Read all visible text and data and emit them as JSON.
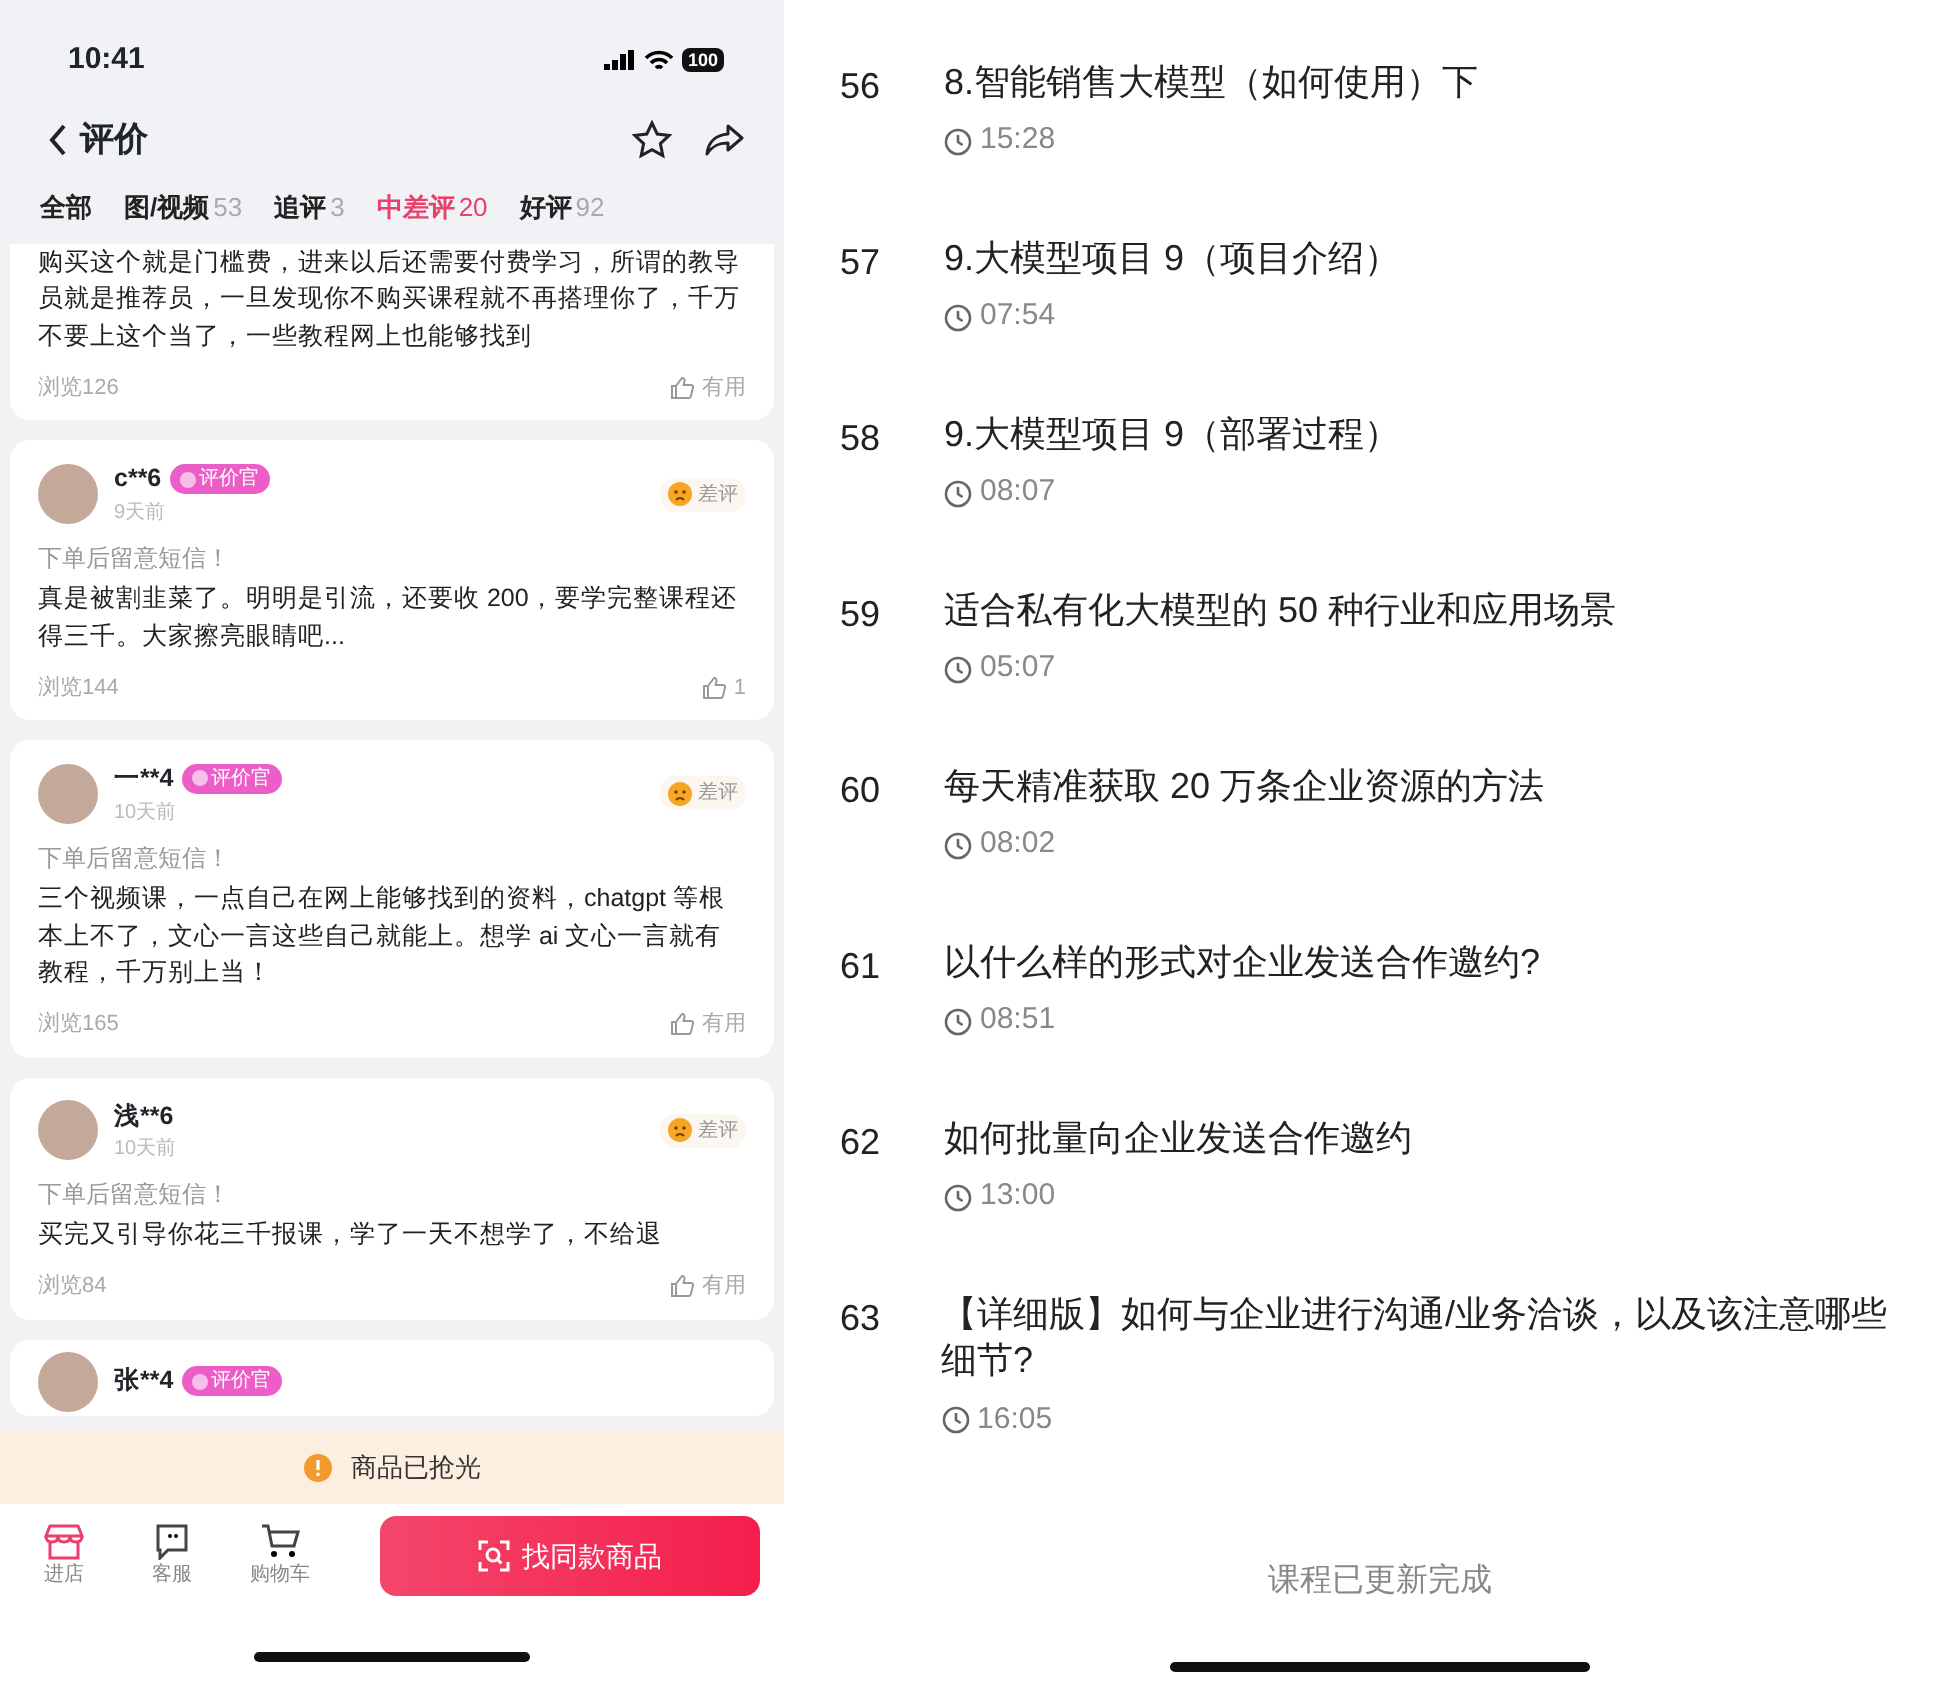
{
  "status_bar": {
    "time": "10:41",
    "battery": "100"
  },
  "header": {
    "title": "评价"
  },
  "tabs": [
    {
      "label": "全部",
      "selected": false
    },
    {
      "label": "图/视频",
      "count": "53",
      "selected": false
    },
    {
      "label": "追评",
      "count": "3",
      "selected": false
    },
    {
      "label": "中差评",
      "count": "20",
      "selected": true
    },
    {
      "label": "好评",
      "count": "92",
      "selected": false
    }
  ],
  "reviews": [
    {
      "text": "购买这个就是门槛费，进来以后还需要付费学习，所谓的教导员就是推荐员，一旦发现你不购买课程就不再搭理你了，千万不要上这个当了，一些教程网上也能够找到",
      "views": "浏览126",
      "helpful": "有用"
    },
    {
      "user": "c**6",
      "badge": "评价官",
      "time": "9天前",
      "rating": "差评",
      "note": "下单后留意短信！",
      "text": "真是被割韭菜了。明明是引流，还要收 200，要学完整课程还得三千。大家擦亮眼睛吧...",
      "views": "浏览144",
      "helpful": "1"
    },
    {
      "user": "一**4",
      "badge": "评价官",
      "time": "10天前",
      "rating": "差评",
      "note": "下单后留意短信！",
      "text": "三个视频课，一点自己在网上能够找到的资料，chatgpt 等根本上不了，文心一言这些自己就能上。想学 ai 文心一言就有教程，千万别上当！",
      "views": "浏览165",
      "helpful": "有用"
    },
    {
      "user": "浅**6",
      "time": "10天前",
      "rating": "差评",
      "note": "下单后留意短信！",
      "text": "买完又引导你花三千报课，学了一天不想学了，不给退",
      "views": "浏览84",
      "helpful": "有用"
    },
    {
      "user": "张**4",
      "badge": "评价官"
    }
  ],
  "notice": "商品已抢光",
  "bottom_bar": {
    "actions": [
      {
        "label": "进店",
        "kind": "store"
      },
      {
        "label": "客服",
        "kind": "chat"
      },
      {
        "label": "购物车",
        "kind": "cart"
      }
    ],
    "button": "找同款商品"
  },
  "lessons": [
    {
      "number": "56",
      "title": "8.智能销售大模型（如何使用）下",
      "duration": "15:28"
    },
    {
      "number": "57",
      "title": "9.大模型项目 9（项目介绍）",
      "duration": "07:54"
    },
    {
      "number": "58",
      "title": "9.大模型项目 9（部署过程）",
      "duration": "08:07"
    },
    {
      "number": "59",
      "title": "适合私有化大模型的 50 种行业和应用场景",
      "duration": "05:07"
    },
    {
      "number": "60",
      "title": "每天精准获取 20 万条企业资源的方法",
      "duration": "08:02"
    },
    {
      "number": "61",
      "title": "以什么样的形式对企业发送合作邀约?",
      "duration": "08:51"
    },
    {
      "number": "62",
      "title": "如何批量向企业发送合作邀约",
      "duration": "13:00"
    },
    {
      "number": "63",
      "title": "【详细版】如何与企业进行沟通/业务洽谈，以及该注意哪些细节?",
      "duration": "16:05"
    }
  ],
  "footer": "课程已更新完成"
}
